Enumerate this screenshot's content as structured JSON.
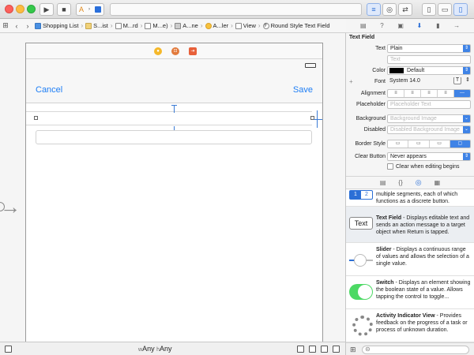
{
  "jumpbar": {
    "crumbs": [
      {
        "label": "Shopping List",
        "icon": "folder-blue-icon"
      },
      {
        "label": "S...ist",
        "icon": "folder-icon"
      },
      {
        "label": "M...rd",
        "icon": "storyboard-icon"
      },
      {
        "label": "M...e)",
        "icon": "storyboard-icon"
      },
      {
        "label": "A...ne",
        "icon": "scene-icon"
      },
      {
        "label": "A...ler",
        "icon": "view-controller-icon"
      },
      {
        "label": "View",
        "icon": "view-icon"
      },
      {
        "label": "Round Style Text Field",
        "icon": "text-field-icon"
      }
    ]
  },
  "scene": {
    "cancel": "Cancel",
    "save": "Save"
  },
  "bottombar": {
    "w_prefix": "w",
    "w_value": "Any",
    "h_prefix": "h",
    "h_value": "Any"
  },
  "inspector": {
    "section": "Text Field",
    "text_label": "Text",
    "text_value": "Plain",
    "text_placeholder": "Text",
    "color_label": "Color",
    "color_value": "Default",
    "font_label": "Font",
    "font_value": "System 14.0",
    "alignment_label": "Alignment",
    "placeholder_label": "Placeholder",
    "placeholder_hint": "Placeholder Text",
    "background_label": "Background",
    "background_hint": "Background Image",
    "disabled_label": "Disabled",
    "disabled_hint": "Disabled Background Image",
    "border_label": "Border Style",
    "clear_label": "Clear Button",
    "clear_value": "Never appears",
    "clear_editing": "Clear when editing begins"
  },
  "library": [
    {
      "title": "",
      "desc": "multiple segments, each of which functions as a discrete button."
    },
    {
      "title": "Text Field",
      "desc": " - Displays editable text and sends an action message to a target object when Return is tapped.",
      "thumb": "Text"
    },
    {
      "title": "Slider",
      "desc": " - Displays a continuous range of values and allows the selection of a single value."
    },
    {
      "title": "Switch",
      "desc": " - Displays an element showing the boolean state of a value. Allows tapping the control to toggle..."
    },
    {
      "title": "Activity Indicator View",
      "desc": " - Provides feedback on the progress of a task or process of unknown duration."
    }
  ],
  "colors": {
    "accent": "#1e7ef5",
    "selection": "#3f83e6",
    "switch_on": "#4cd964"
  }
}
